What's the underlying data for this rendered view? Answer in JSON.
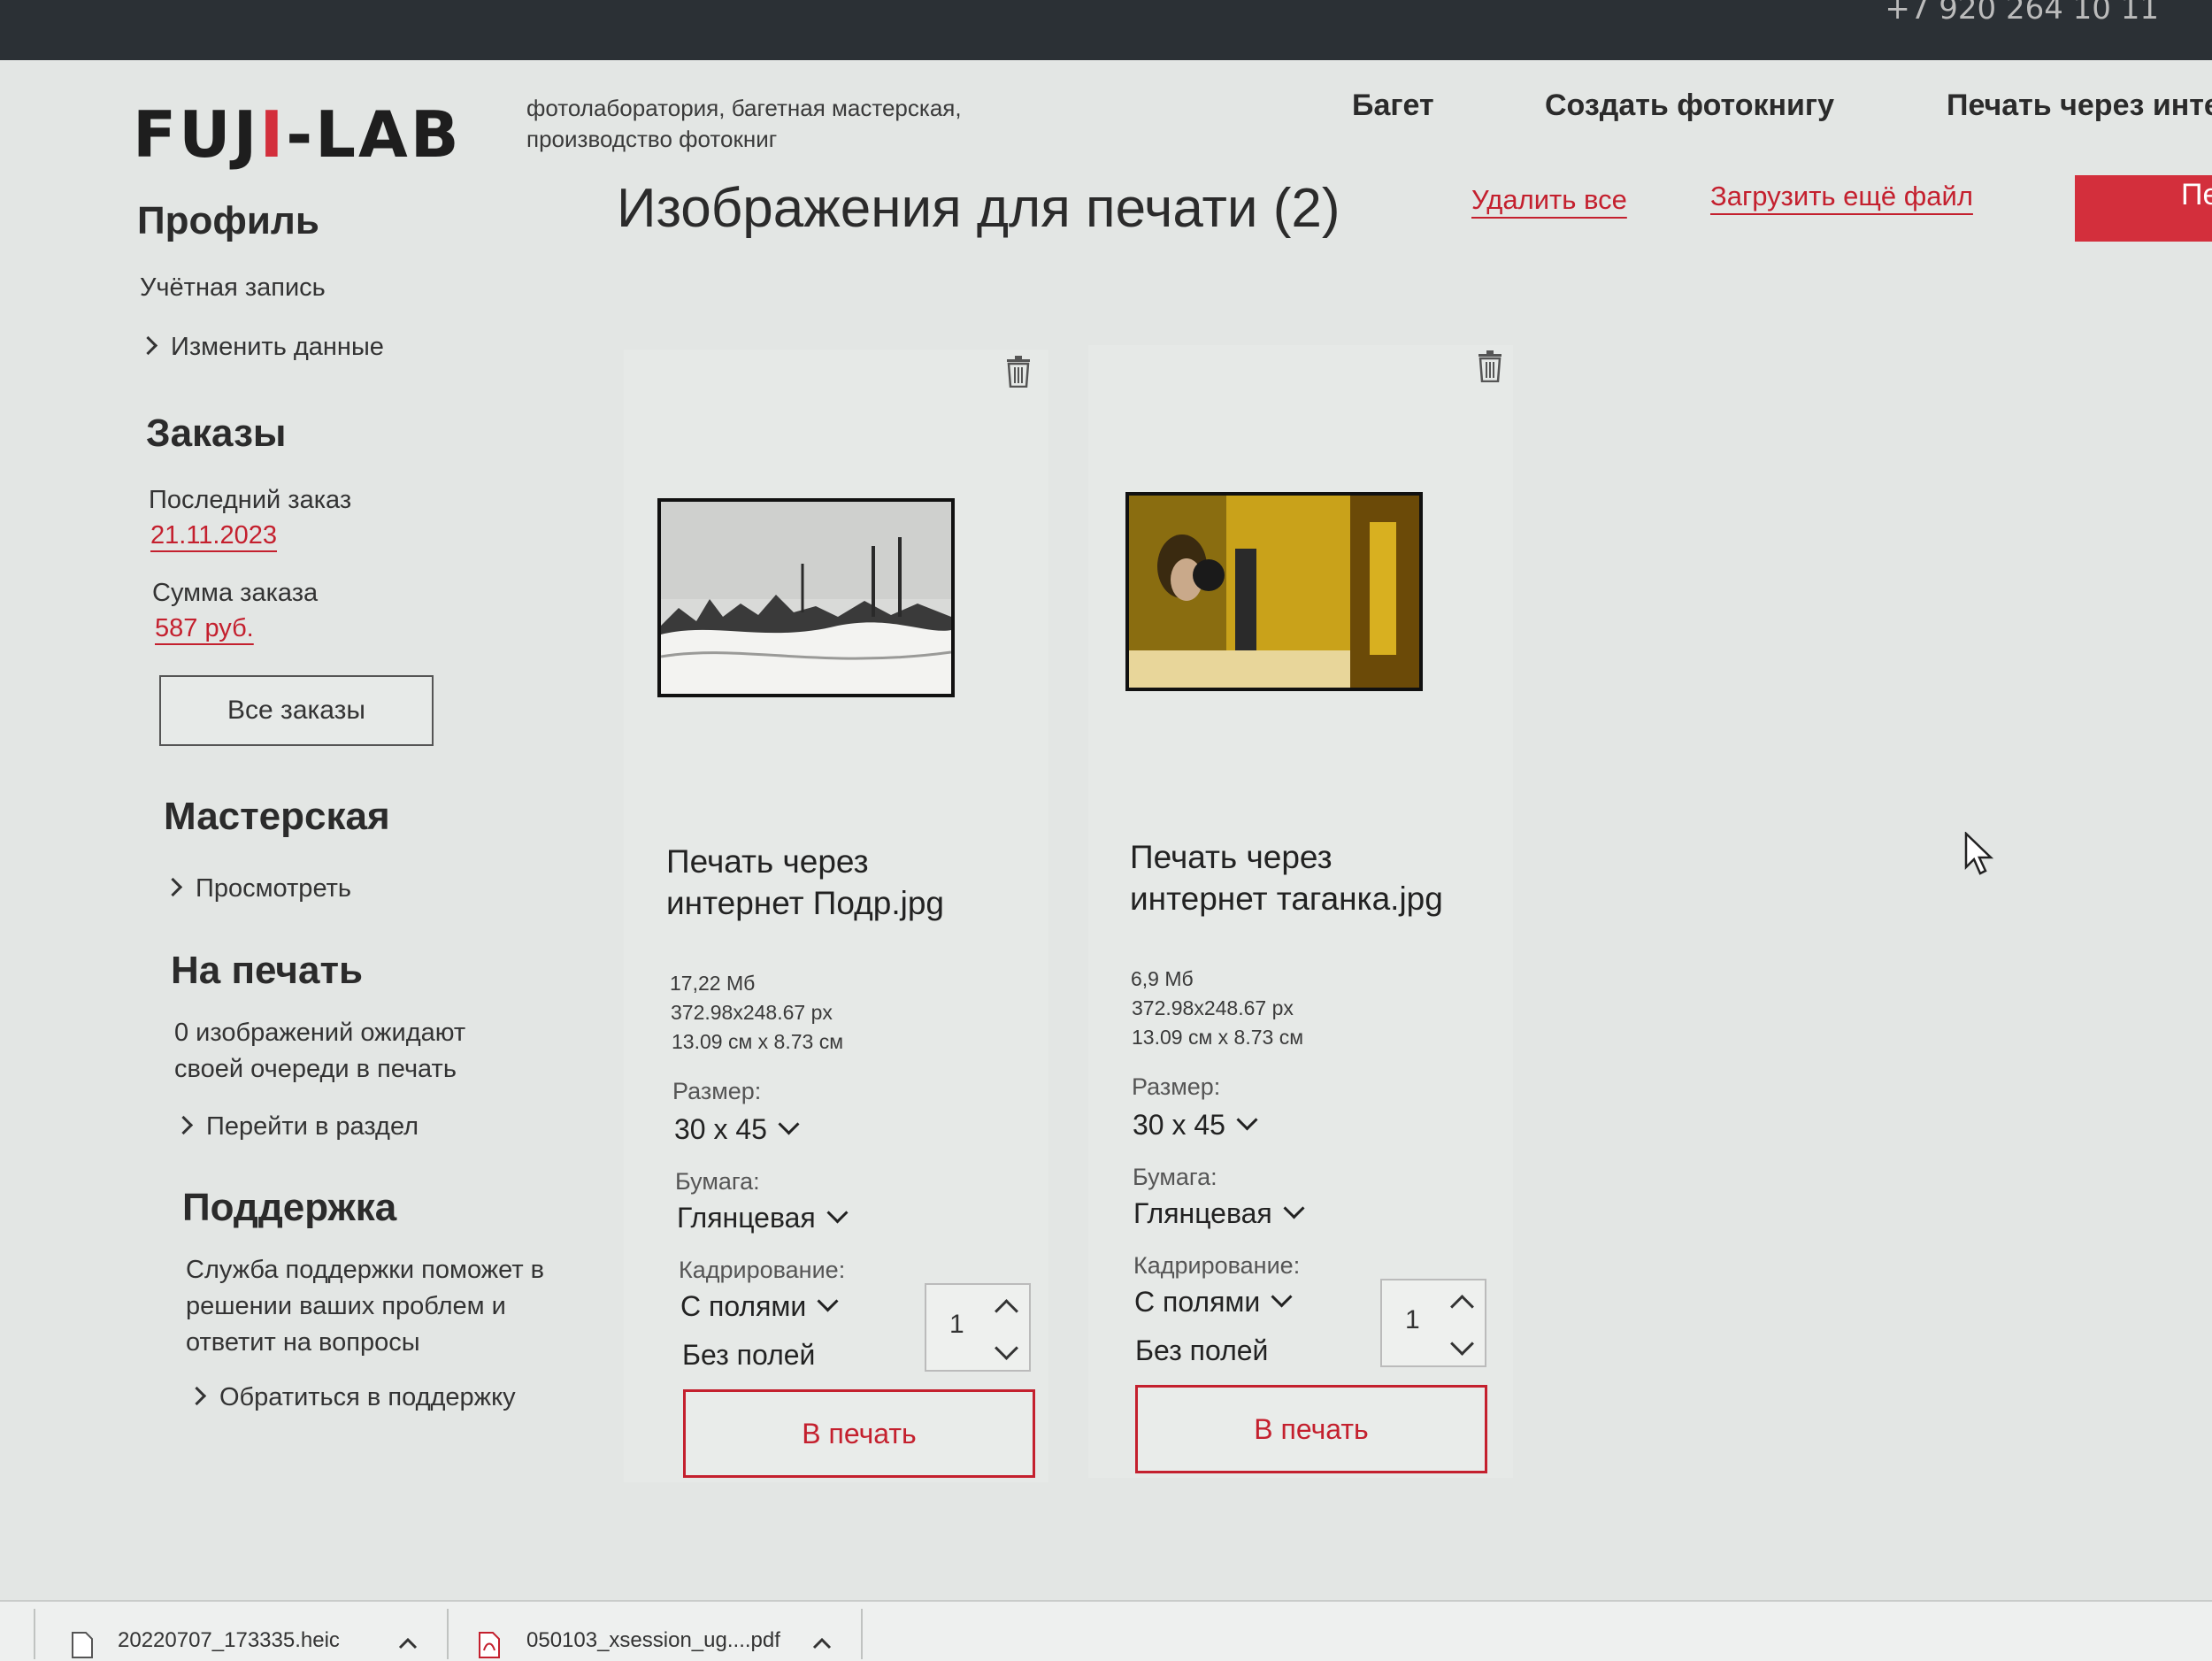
{
  "top_bar": {
    "phone": "+7 920 264 10 11"
  },
  "header": {
    "logo": {
      "part1": "FUJ",
      "accent": "I",
      "part2": "-LAB"
    },
    "tagline": "фотолаборатория, багетная мастерская, производство фотокниг",
    "nav": [
      "Багет",
      "Создать фотокнигу",
      "Печать через инте"
    ]
  },
  "sidebar": {
    "profile": {
      "title": "Профиль",
      "account": "Учётная запись",
      "edit": "Изменить данные"
    },
    "orders": {
      "title": "Заказы",
      "last_order_label": "Последний заказ",
      "last_order_date": "21.11.2023",
      "sum_label": "Сумма заказа",
      "sum_value": "587 руб.",
      "all_orders_button": "Все заказы"
    },
    "workshop": {
      "title": "Мастерская",
      "view": "Просмотреть"
    },
    "to_print": {
      "title": "На печать",
      "status": "0 изображений ожидают своей очереди в печать",
      "goto": "Перейти в раздел"
    },
    "support": {
      "title": "Поддержка",
      "text": "Служба поддержки поможет в решении ваших проблем и ответит на вопросы",
      "contact": "Обратиться в поддержку"
    }
  },
  "main": {
    "title": "Изображения для печати (2)",
    "delete_all": "Удалить все",
    "upload_more": "Загрузить ещё файл",
    "print_button": "Пе",
    "cards": [
      {
        "title": "Печать через интернет Подр.jpg",
        "size_mb": "17,22 Мб",
        "px": "372.98x248.67 px",
        "cm": "13.09 см x 8.73 см",
        "size_label": "Размер:",
        "size_value": "30 x 45",
        "paper_label": "Бумага:",
        "paper_value": "Глянцевая",
        "crop_label": "Кадрирование:",
        "crop_value": "С полями",
        "crop_alt": "Без полей",
        "quantity": "1",
        "print_label": "В печать"
      },
      {
        "title": "Печать через интернет таганка.jpg",
        "size_mb": "6,9 Мб",
        "px": "372.98x248.67 px",
        "cm": "13.09 см x 8.73 см",
        "size_label": "Размер:",
        "size_value": "30 x 45",
        "paper_label": "Бумага:",
        "paper_value": "Глянцевая",
        "crop_label": "Кадрирование:",
        "crop_value": "С полями",
        "crop_alt": "Без полей",
        "quantity": "1",
        "print_label": "В печать"
      }
    ]
  },
  "downloads": [
    {
      "name": "20220707_173335.heic"
    },
    {
      "name": "050103_xsession_ug....pdf"
    }
  ],
  "colors": {
    "accent_red": "#c4202e",
    "topbar": "#2b3035"
  }
}
